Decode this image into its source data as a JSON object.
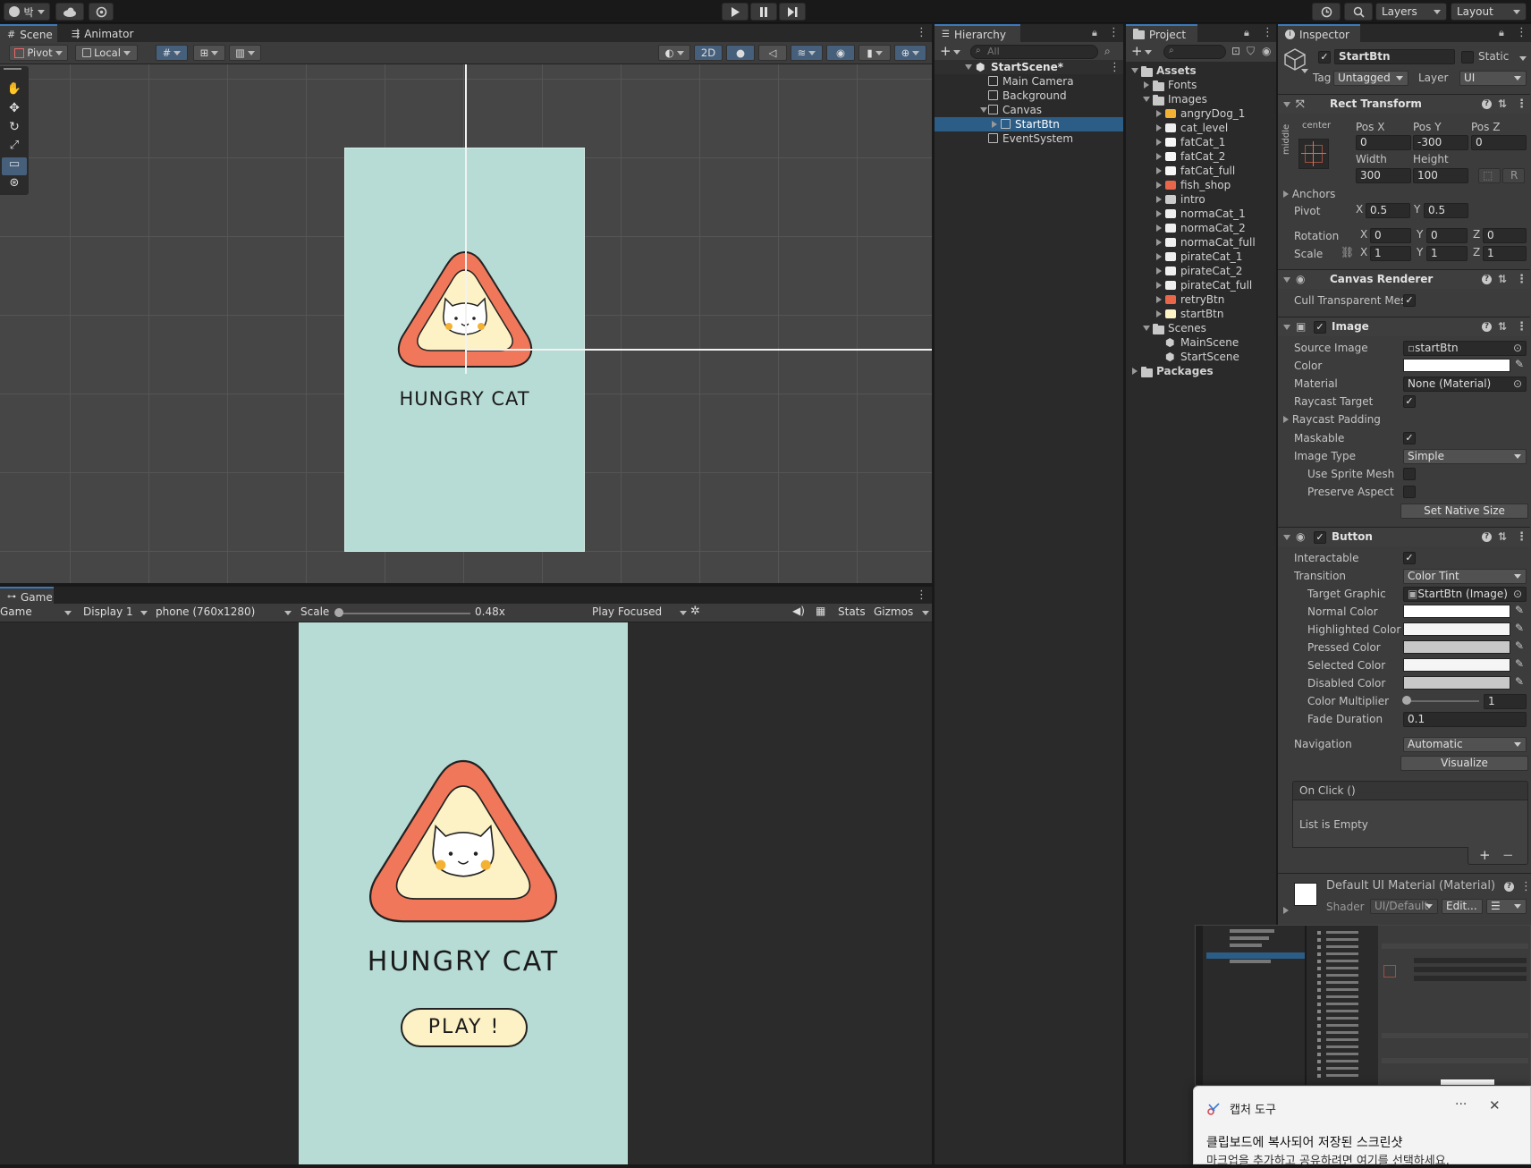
{
  "topbar": {
    "account": "박",
    "layers": "Layers",
    "layout": "Layout"
  },
  "scene_tabs": {
    "scene": "Scene",
    "animator": "Animator"
  },
  "scene_toolbar": {
    "pivot": "Pivot",
    "local": "Local",
    "mode2d": "2D"
  },
  "scene_art": {
    "title": "HUNGRY CAT"
  },
  "game_tab": "Game",
  "game_toolbar": {
    "game": "Game",
    "display": "Display 1",
    "resolution": "phone (760x1280)",
    "scale_label": "Scale",
    "scale_value": "0.48x",
    "play_focused": "Play Focused",
    "stats": "Stats",
    "gizmos": "Gizmos"
  },
  "game_art": {
    "title": "HUNGRY CAT",
    "play": "PLAY !"
  },
  "hierarchy": {
    "tab": "Hierarchy",
    "search_placeholder": "All",
    "scene": "StartScene*",
    "items": [
      "Main Camera",
      "Background",
      "Canvas",
      "StartBtn",
      "EventSystem"
    ]
  },
  "project": {
    "tab": "Project",
    "assets": "Assets",
    "fonts": "Fonts",
    "images": "Images",
    "image_items": [
      "angryDog_1",
      "cat_level",
      "fatCat_1",
      "fatCat_2",
      "fatCat_full",
      "fish_shop",
      "intro",
      "normaCat_1",
      "normaCat_2",
      "normaCat_full",
      "pirateCat_1",
      "pirateCat_2",
      "pirateCat_full",
      "retryBtn",
      "startBtn"
    ],
    "scenes": "Scenes",
    "scene_items": [
      "MainScene",
      "StartScene"
    ],
    "packages": "Packages"
  },
  "inspector": {
    "tab": "Inspector",
    "object_name": "StartBtn",
    "static_label": "Static",
    "tag_label": "Tag",
    "tag_value": "Untagged",
    "layer_label": "Layer",
    "layer_value": "UI",
    "rect": {
      "title": "Rect Transform",
      "anchor_h": "center",
      "anchor_v": "middle",
      "posx_label": "Pos X",
      "posy_label": "Pos Y",
      "posz_label": "Pos Z",
      "posx": "0",
      "posy": "-300",
      "posz": "0",
      "width_label": "Width",
      "height_label": "Height",
      "width": "300",
      "height": "100",
      "r_btn": "R",
      "anchors": "Anchors",
      "pivot": "Pivot",
      "pivot_x": "0.5",
      "pivot_y": "0.5",
      "rotation": "Rotation",
      "rot_x": "0",
      "rot_y": "0",
      "rot_z": "0",
      "scale": "Scale",
      "scale_x": "1",
      "scale_y": "1",
      "scale_z": "1",
      "x": "X",
      "y": "Y",
      "z": "Z"
    },
    "canvas_renderer": {
      "title": "Canvas Renderer",
      "cull": "Cull Transparent Mes"
    },
    "image": {
      "title": "Image",
      "source_image": "Source Image",
      "source_value": "startBtn",
      "color": "Color",
      "material": "Material",
      "material_value": "None (Material)",
      "raycast_target": "Raycast Target",
      "raycast_padding": "Raycast Padding",
      "maskable": "Maskable",
      "image_type": "Image Type",
      "image_type_value": "Simple",
      "use_sprite_mesh": "Use Sprite Mesh",
      "preserve_aspect": "Preserve Aspect",
      "set_native": "Set Native Size"
    },
    "button": {
      "title": "Button",
      "interactable": "Interactable",
      "transition": "Transition",
      "transition_value": "Color Tint",
      "target_graphic": "Target Graphic",
      "target_value": "StartBtn (Image)",
      "normal": "Normal Color",
      "highlighted": "Highlighted Color",
      "pressed": "Pressed Color",
      "selected": "Selected Color",
      "disabled": "Disabled Color",
      "multiplier": "Color Multiplier",
      "multiplier_value": "1",
      "fade": "Fade Duration",
      "fade_value": "0.1",
      "navigation": "Navigation",
      "navigation_value": "Automatic",
      "visualize": "Visualize",
      "onclick": "On Click ()",
      "list_empty": "List is Empty"
    },
    "material": {
      "name": "Default UI Material (Material)",
      "shader_label": "Shader",
      "shader_value": "UI/Default",
      "edit": "Edit..."
    }
  },
  "notification": {
    "app": "캡처 도구",
    "line1": "클립보드에 복사되어 저장된 스크린샷",
    "line2": "마크업을 추가하고 공유하려면 여기를 선택하세요."
  },
  "colors": {
    "bg_teal": "#b7dcd5",
    "cat_orange": "#f0775a",
    "cat_cream": "#fdf2c5",
    "cat_cheek": "#f3b233",
    "accent_blue": "#2c5d87"
  }
}
